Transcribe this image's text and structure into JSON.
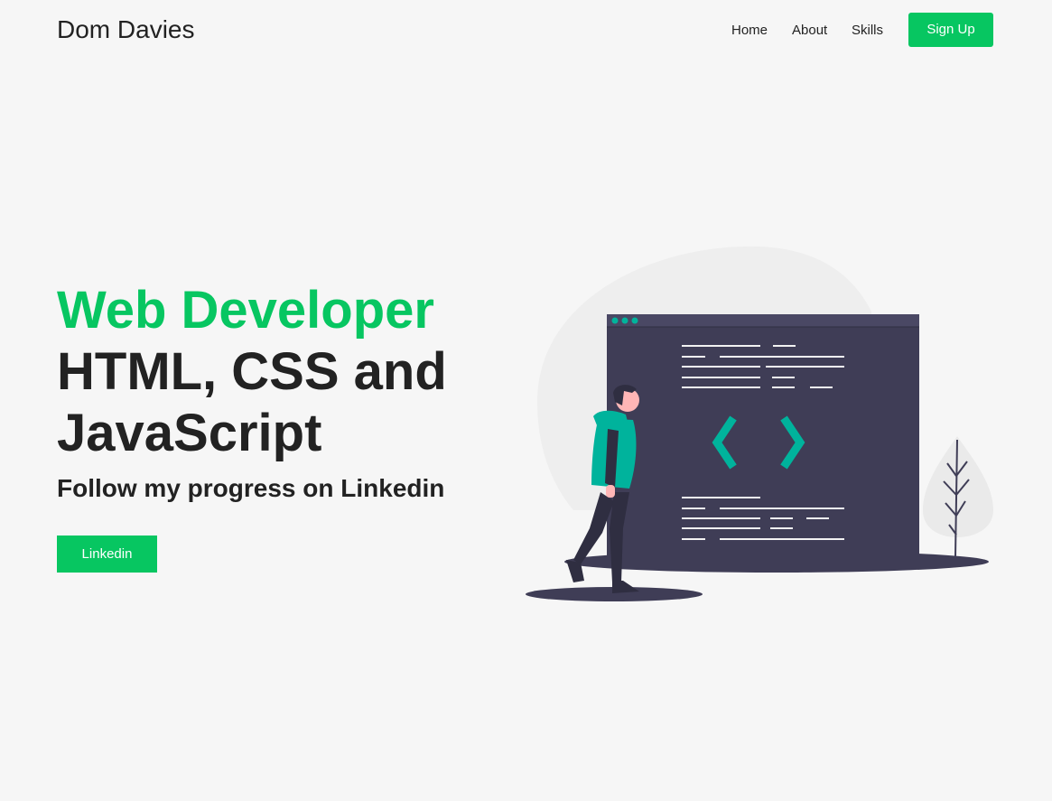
{
  "header": {
    "brand": "Dom Davies",
    "nav": {
      "home": "Home",
      "about": "About",
      "skills": "Skills"
    },
    "signup_label": "Sign Up"
  },
  "hero": {
    "title_accent": "Web Developer",
    "title_line2": "HTML, CSS and",
    "title_line3": "JavaScript",
    "subtitle": "Follow my progress on Linkedin",
    "cta_label": "Linkedin"
  },
  "illustration": {
    "icon": "developer-code-window-illustration"
  },
  "colors": {
    "accent": "#07c661",
    "background": "#f6f6f6",
    "text": "#222222",
    "window_dark": "#3f3d56",
    "teal": "#00b39c"
  }
}
